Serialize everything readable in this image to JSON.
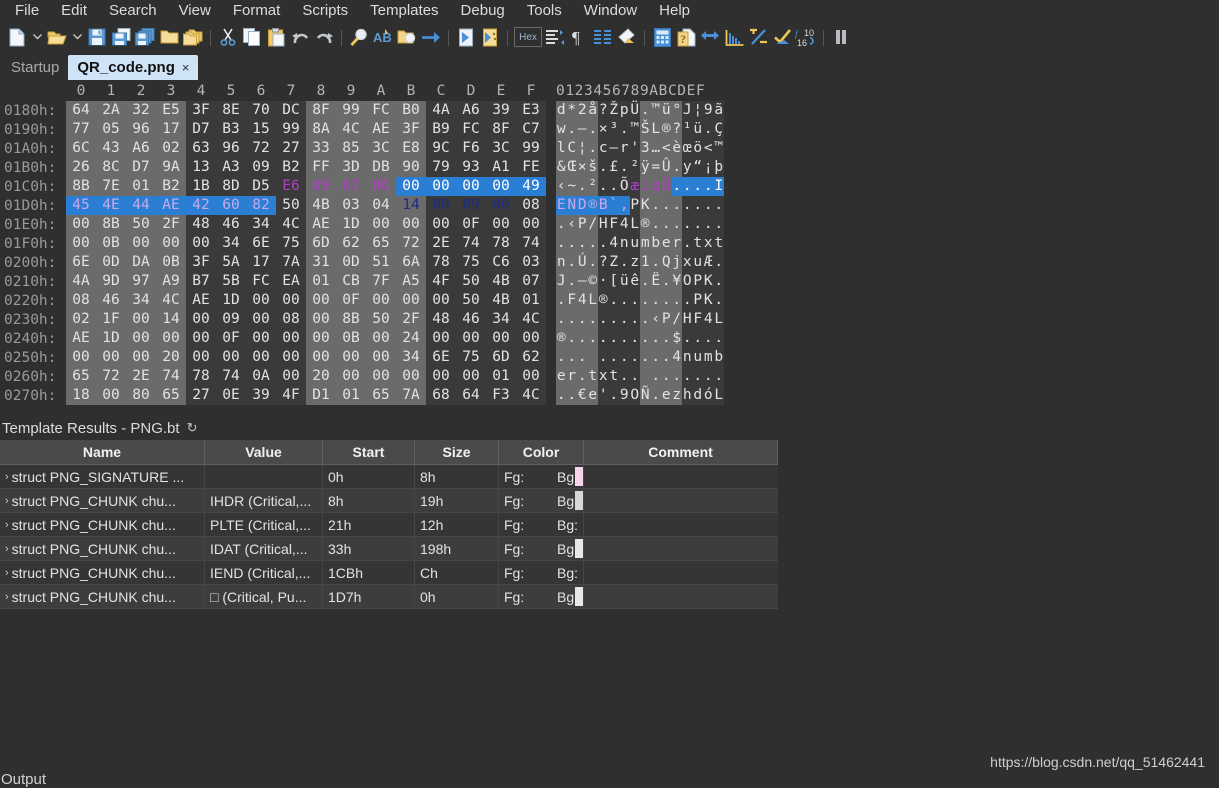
{
  "menu": {
    "items": [
      "File",
      "Edit",
      "Search",
      "View",
      "Format",
      "Scripts",
      "Templates",
      "Debug",
      "Tools",
      "Window",
      "Help"
    ]
  },
  "toolbar": {
    "hex_label": "Hex",
    "icons": [
      "new-file-icon",
      "new-file-dropdown-icon",
      "open-folder-icon",
      "open-dropdown-icon",
      "save-icon",
      "save-as-icon",
      "save-all-icon",
      "folder-icon",
      "folders-icon",
      "cut-icon",
      "copy-icon",
      "paste-icon",
      "undo-icon",
      "redo-icon",
      "find-icon",
      "replace-icon",
      "find-in-files-icon",
      "goto-icon",
      "run-script-icon",
      "run-template-icon",
      "hex-mode-button",
      "inspector-icon",
      "paragraph-icon",
      "columns-icon",
      "highlight-icon",
      "calculator-icon",
      "file-info-icon",
      "compare-icon",
      "histogram-icon",
      "checksum-icon",
      "check-icon",
      "base-convert-icon",
      "pause-icon"
    ]
  },
  "tabs": {
    "items": [
      {
        "label": "Startup",
        "active": false,
        "closable": false
      },
      {
        "label": "QR_code.png",
        "active": true,
        "closable": true,
        "close_glyph": "×"
      }
    ]
  },
  "hex": {
    "column_headers": [
      "0",
      "1",
      "2",
      "3",
      "4",
      "5",
      "6",
      "7",
      "8",
      "9",
      "A",
      "B",
      "C",
      "D",
      "E",
      "F"
    ],
    "ascii_header": "0123456789ABCDEF",
    "rows": [
      {
        "offset": "0180h:",
        "bytes": [
          "64",
          "2A",
          "32",
          "E5",
          "3F",
          "8E",
          "70",
          "DC",
          "8F",
          "99",
          "FC",
          "B0",
          "4A",
          "A6",
          "39",
          "E3"
        ],
        "ascii": "d*2å?ŽpÜ.™ü°J¦9ã"
      },
      {
        "offset": "0190h:",
        "bytes": [
          "77",
          "05",
          "96",
          "17",
          "D7",
          "B3",
          "15",
          "99",
          "8A",
          "4C",
          "AE",
          "3F",
          "B9",
          "FC",
          "8F",
          "C7"
        ],
        "ascii": "w.–.×³.™ŠL®?¹ü.Ç"
      },
      {
        "offset": "01A0h:",
        "bytes": [
          "6C",
          "43",
          "A6",
          "02",
          "63",
          "96",
          "72",
          "27",
          "33",
          "85",
          "3C",
          "E8",
          "9C",
          "F6",
          "3C",
          "99"
        ],
        "ascii": "lC¦.c–r'3…<èœö<™"
      },
      {
        "offset": "01B0h:",
        "bytes": [
          "26",
          "8C",
          "D7",
          "9A",
          "13",
          "A3",
          "09",
          "B2",
          "FF",
          "3D",
          "DB",
          "90",
          "79",
          "93",
          "A1",
          "FE"
        ],
        "ascii": "&Œ×š.£.²ÿ=Û.y“¡þ"
      },
      {
        "offset": "01C0h:",
        "bytes": [
          "8B",
          "7E",
          "01",
          "B2",
          "1B",
          "8D",
          "D5",
          "E6",
          "69",
          "67",
          "86",
          "00",
          "00",
          "00",
          "00",
          "49"
        ],
        "ascii": "‹~.²..ÕæigÜ....I"
      },
      {
        "offset": "01D0h:",
        "bytes": [
          "45",
          "4E",
          "44",
          "AE",
          "42",
          "60",
          "82",
          "50",
          "4B",
          "03",
          "04",
          "14",
          "00",
          "09",
          "00",
          "08"
        ],
        "ascii": "END®B`‚PK......."
      },
      {
        "offset": "01E0h:",
        "bytes": [
          "00",
          "8B",
          "50",
          "2F",
          "48",
          "46",
          "34",
          "4C",
          "AE",
          "1D",
          "00",
          "00",
          "00",
          "0F",
          "00",
          "00"
        ],
        "ascii": ".‹P/HF4L®......."
      },
      {
        "offset": "01F0h:",
        "bytes": [
          "00",
          "0B",
          "00",
          "00",
          "00",
          "34",
          "6E",
          "75",
          "6D",
          "62",
          "65",
          "72",
          "2E",
          "74",
          "78",
          "74"
        ],
        "ascii": ".....4number.txt"
      },
      {
        "offset": "0200h:",
        "bytes": [
          "6E",
          "0D",
          "DA",
          "0B",
          "3F",
          "5A",
          "17",
          "7A",
          "31",
          "0D",
          "51",
          "6A",
          "78",
          "75",
          "C6",
          "03"
        ],
        "ascii": "n.Ú.?Z.z1.QjxuÆ."
      },
      {
        "offset": "0210h:",
        "bytes": [
          "4A",
          "9D",
          "97",
          "A9",
          "B7",
          "5B",
          "FC",
          "EA",
          "01",
          "CB",
          "7F",
          "A5",
          "4F",
          "50",
          "4B",
          "07"
        ],
        "ascii": "J.—©·[üê.Ë.¥OPK."
      },
      {
        "offset": "0220h:",
        "bytes": [
          "08",
          "46",
          "34",
          "4C",
          "AE",
          "1D",
          "00",
          "00",
          "00",
          "0F",
          "00",
          "00",
          "00",
          "50",
          "4B",
          "01"
        ],
        "ascii": ".F4L®........PK."
      },
      {
        "offset": "0230h:",
        "bytes": [
          "02",
          "1F",
          "00",
          "14",
          "00",
          "09",
          "00",
          "08",
          "00",
          "8B",
          "50",
          "2F",
          "48",
          "46",
          "34",
          "4C"
        ],
        "ascii": ".........‹P/HF4L"
      },
      {
        "offset": "0240h:",
        "bytes": [
          "AE",
          "1D",
          "00",
          "00",
          "00",
          "0F",
          "00",
          "00",
          "00",
          "0B",
          "00",
          "24",
          "00",
          "00",
          "00",
          "00"
        ],
        "ascii": "®..........$...."
      },
      {
        "offset": "0250h:",
        "bytes": [
          "00",
          "00",
          "00",
          "20",
          "00",
          "00",
          "00",
          "00",
          "00",
          "00",
          "00",
          "34",
          "6E",
          "75",
          "6D",
          "62"
        ],
        "ascii": "... .......4numb"
      },
      {
        "offset": "0260h:",
        "bytes": [
          "65",
          "72",
          "2E",
          "74",
          "78",
          "74",
          "0A",
          "00",
          "20",
          "00",
          "00",
          "00",
          "00",
          "00",
          "01",
          "00"
        ],
        "ascii": "er.txt.. ......."
      },
      {
        "offset": "0270h:",
        "bytes": [
          "18",
          "00",
          "80",
          "65",
          "27",
          "0E",
          "39",
          "4F",
          "D1",
          "01",
          "65",
          "7A",
          "68",
          "64",
          "F3",
          "4C"
        ],
        "ascii": "..€e'.9OÑ.ezhdóL"
      }
    ],
    "colors": {
      "selection_bg": "#2a7fd4",
      "magenta_text": "#b43ec8",
      "navy_text": "#1b2a8a",
      "group_even_bg": "#6b6b6b",
      "group_odd_bg": "#3a3a3a"
    }
  },
  "template_results": {
    "title": "Template Results - PNG.bt",
    "refresh_glyph": "↻",
    "columns": [
      "Name",
      "Value",
      "Start",
      "Size",
      "Color",
      "Comment"
    ],
    "color_labels": {
      "fg": "Fg:",
      "bg": "Bg:"
    },
    "expand_glyph": "›",
    "rows": [
      {
        "name": "struct PNG_SIGNATURE ...",
        "value": "",
        "start": "0h",
        "size": "8h",
        "swatch": "#f7d6ec",
        "comment": ""
      },
      {
        "name": "struct PNG_CHUNK chu...",
        "value": "IHDR  (Critical,...",
        "start": "8h",
        "size": "19h",
        "swatch": "#d8d8d8",
        "comment": ""
      },
      {
        "name": "struct PNG_CHUNK chu...",
        "value": "PLTE  (Critical,...",
        "start": "21h",
        "size": "12h",
        "swatch": "",
        "comment": ""
      },
      {
        "name": "struct PNG_CHUNK chu...",
        "value": "IDAT  (Critical,...",
        "start": "33h",
        "size": "198h",
        "swatch": "#e8e8e8",
        "comment": ""
      },
      {
        "name": "struct PNG_CHUNK chu...",
        "value": "IEND  (Critical,...",
        "start": "1CBh",
        "size": "Ch",
        "swatch": "",
        "comment": ""
      },
      {
        "name": "struct PNG_CHUNK chu...",
        "value": "□ (Critical, Pu...",
        "start": "1D7h",
        "size": "0h",
        "swatch": "#e8e8e8",
        "comment": ""
      }
    ]
  },
  "footer": {
    "output_label": "Output",
    "watermark": "https://blog.csdn.net/qq_51462441"
  }
}
